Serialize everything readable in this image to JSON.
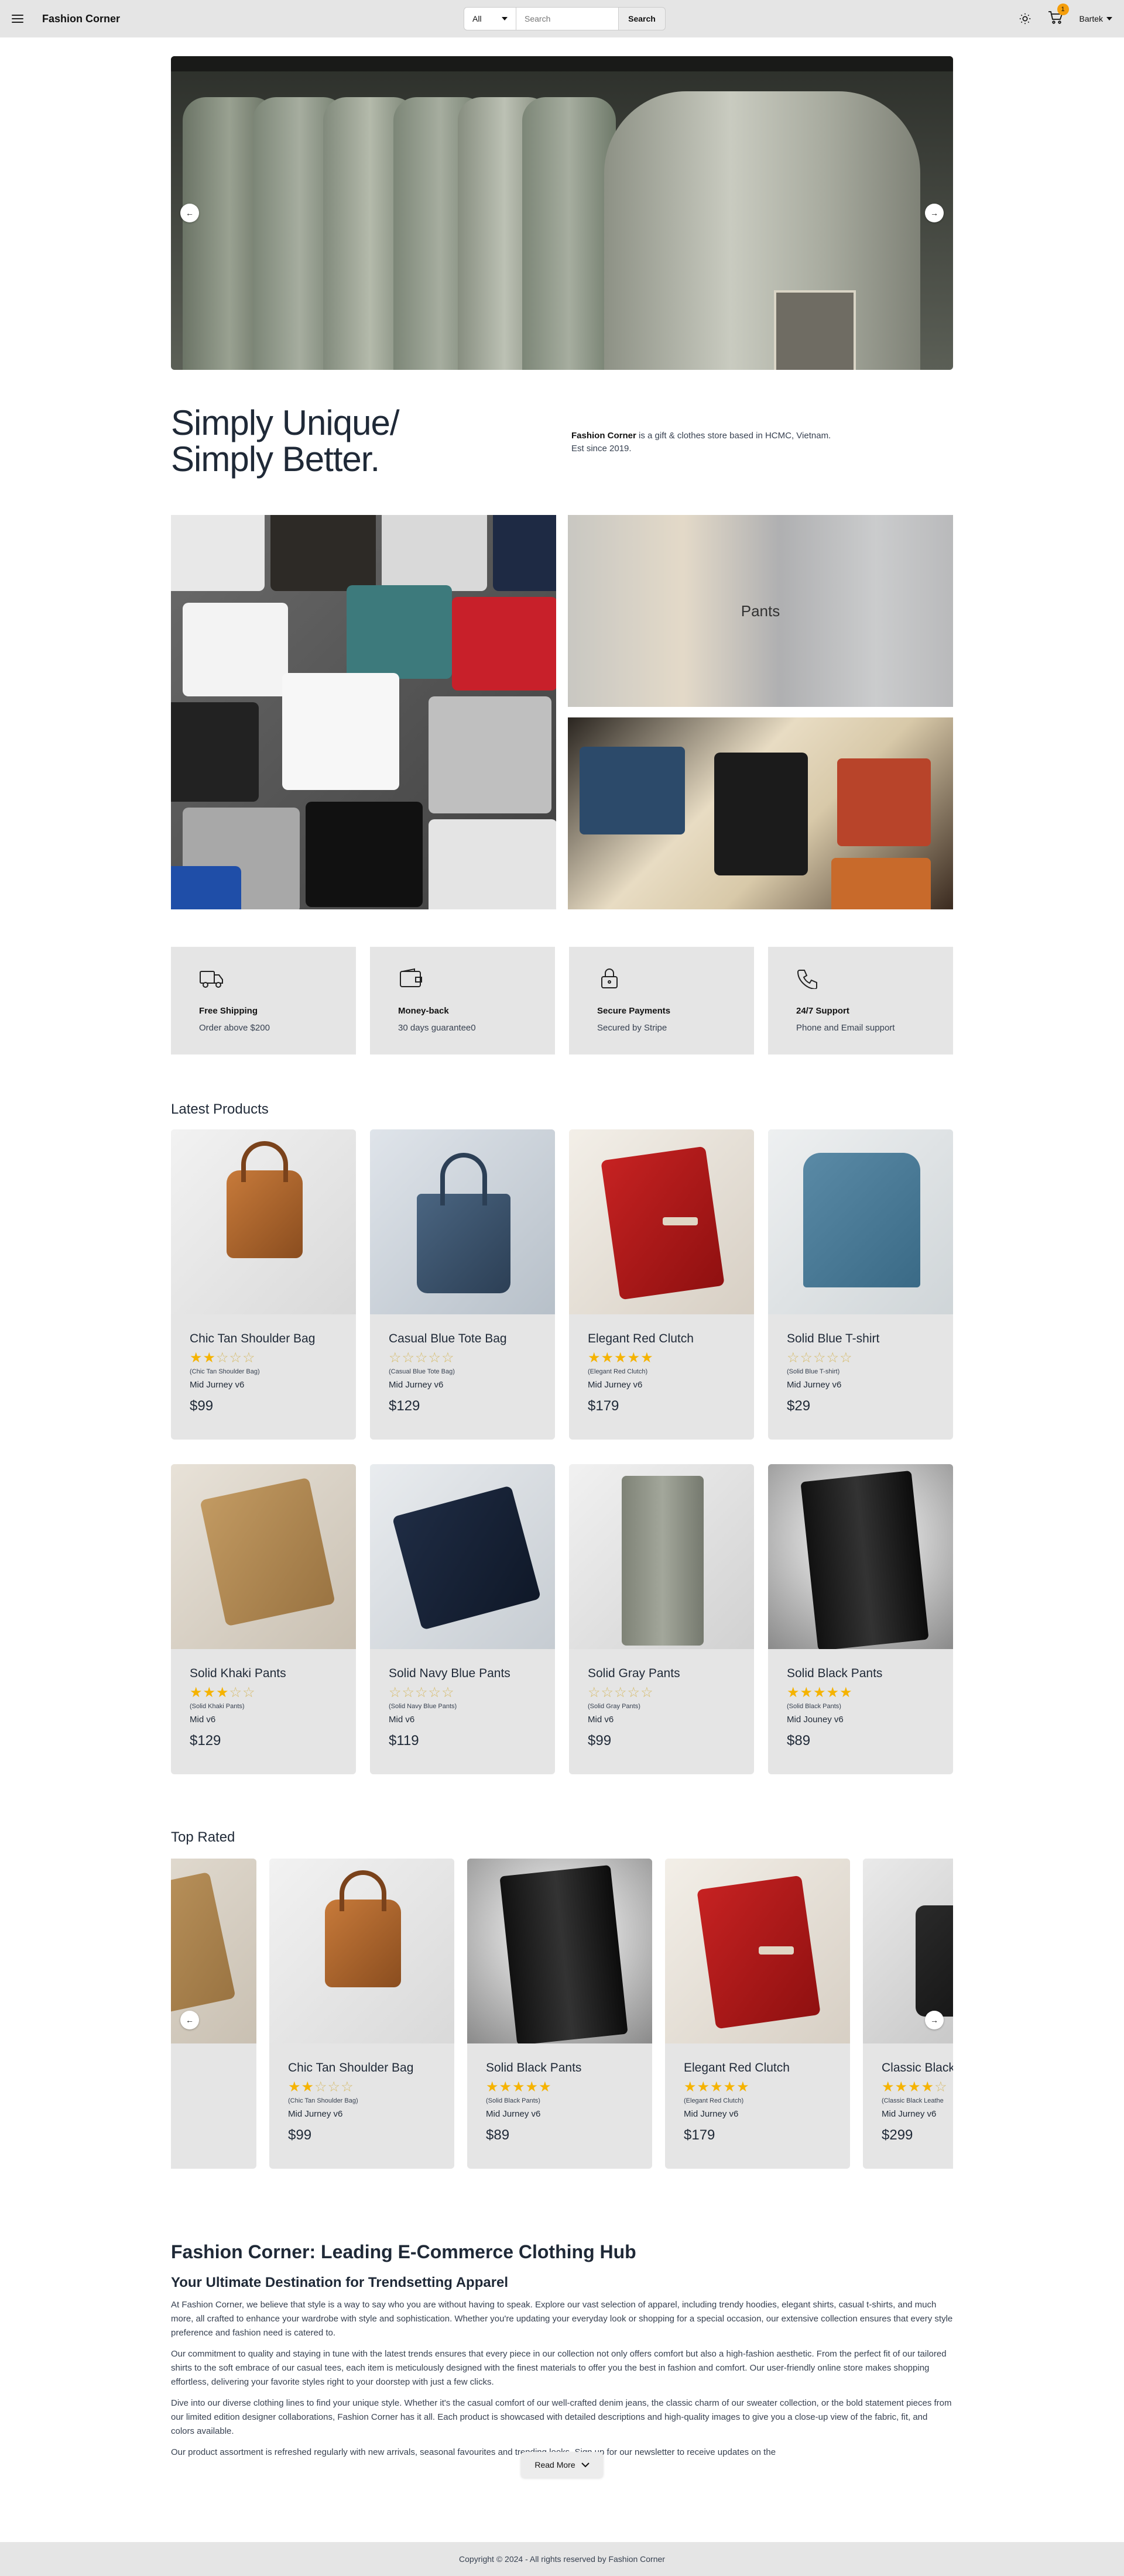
{
  "nav": {
    "brand": "Fashion Corner",
    "category_selected": "All",
    "search_placeholder": "Search",
    "search_button": "Search",
    "cart_count": "1",
    "user_name": "Bartek"
  },
  "hero": {
    "prev_label": "←",
    "next_label": "→"
  },
  "intro": {
    "headline_line1": "Simply Unique/",
    "headline_line2": "Simply Better.",
    "brand_bold": "Fashion Corner",
    "about_rest": " is a gift & clothes store based in HCMC, Vietnam. Est since 2019."
  },
  "categories": {
    "pants_label": "Pants"
  },
  "features": [
    {
      "icon": "truck-icon",
      "title": "Free Shipping",
      "sub": "Order above $200"
    },
    {
      "icon": "wallet-icon",
      "title": "Money-back",
      "sub": "30 days guarantee0"
    },
    {
      "icon": "lock-icon",
      "title": "Secure Payments",
      "sub": "Secured by Stripe"
    },
    {
      "icon": "phone-icon",
      "title": "24/7 Support",
      "sub": "Phone and Email support"
    }
  ],
  "latest": {
    "title": "Latest Products",
    "products": [
      {
        "name": "Chic Tan Shoulder Bag",
        "rating": 2,
        "sub": "(Chic Tan Shoulder Bag)",
        "brand": "Mid Jurney v6",
        "price": "$99"
      },
      {
        "name": "Casual Blue Tote Bag",
        "rating": 0,
        "sub": "(Casual Blue Tote Bag)",
        "brand": "Mid Jurney v6",
        "price": "$129"
      },
      {
        "name": "Elegant Red Clutch",
        "rating": 5,
        "sub": "(Elegant Red Clutch)",
        "brand": "Mid Jurney v6",
        "price": "$179"
      },
      {
        "name": "Solid Blue T-shirt",
        "rating": 0,
        "sub": "(Solid Blue T-shirt)",
        "brand": "Mid Jurney v6",
        "price": "$29"
      },
      {
        "name": "Solid Khaki Pants",
        "rating": 3,
        "sub": "(Solid Khaki Pants)",
        "brand": "Mid v6",
        "price": "$129"
      },
      {
        "name": "Solid Navy Blue Pants",
        "rating": 0,
        "sub": "(Solid Navy Blue Pants)",
        "brand": "Mid v6",
        "price": "$119"
      },
      {
        "name": "Solid Gray Pants",
        "rating": 0,
        "sub": "(Solid Gray Pants)",
        "brand": "Mid v6",
        "price": "$99"
      },
      {
        "name": "Solid Black Pants",
        "rating": 5,
        "sub": "(Solid Black Pants)",
        "brand": "Mid Jouney v6",
        "price": "$89"
      }
    ]
  },
  "top_rated": {
    "title": "Top Rated",
    "products": [
      {
        "name": "nts",
        "rating": 0,
        "sub": "",
        "brand": "",
        "price": ""
      },
      {
        "name": "Chic Tan Shoulder Bag",
        "rating": 2,
        "sub": "(Chic Tan Shoulder Bag)",
        "brand": "Mid Jurney v6",
        "price": "$99"
      },
      {
        "name": "Solid Black Pants",
        "rating": 5,
        "sub": "(Solid Black Pants)",
        "brand": "Mid Jurney v6",
        "price": "$89"
      },
      {
        "name": "Elegant Red Clutch",
        "rating": 5,
        "sub": "(Elegant Red Clutch)",
        "brand": "Mid Jurney v6",
        "price": "$179"
      },
      {
        "name": "Classic Black",
        "rating": 4,
        "sub": "(Classic Black Leathe",
        "brand": "Mid Jurney v6",
        "price": "$299"
      }
    ]
  },
  "seo": {
    "h1": "Fashion Corner: Leading E-Commerce Clothing Hub",
    "h2": "Your Ultimate Destination for Trendsetting Apparel",
    "p1": "At Fashion Corner, we believe that style is a way to say who you are without having to speak. Explore our vast selection of apparel, including trendy hoodies, elegant shirts, casual t-shirts, and much more, all crafted to enhance your wardrobe with style and sophistication. Whether you're updating your everyday look or shopping for a special occasion, our extensive collection ensures that every style preference and fashion need is catered to.",
    "p2": "Our commitment to quality and staying in tune with the latest trends ensures that every piece in our collection not only offers comfort but also a high-fashion aesthetic. From the perfect fit of our tailored shirts to the soft embrace of our casual tees, each item is meticulously designed with the finest materials to offer you the best in fashion and comfort. Our user-friendly online store makes shopping effortless, delivering your favorite styles right to your doorstep with just a few clicks.",
    "p3": "Dive into our diverse clothing lines to find your unique style. Whether it's the casual comfort of our well-crafted denim jeans, the classic charm of our sweater collection, or the bold statement pieces from our limited edition designer collaborations, Fashion Corner has it all. Each product is showcased with detailed descriptions and high-quality images to give you a close-up view of the fabric, fit, and colors available.",
    "p4": "Our product assortment is refreshed regularly with new arrivals, seasonal favourites and trending looks. Sign up for our newsletter to receive updates on the",
    "read_more": "Read More"
  },
  "footer": {
    "copyright": "Copyright © 2024 - All rights reserved by Fashion Corner"
  },
  "colors": {
    "star": "#f5b301",
    "badge": "#f59e0b",
    "card_bg": "#e5e5e5"
  }
}
